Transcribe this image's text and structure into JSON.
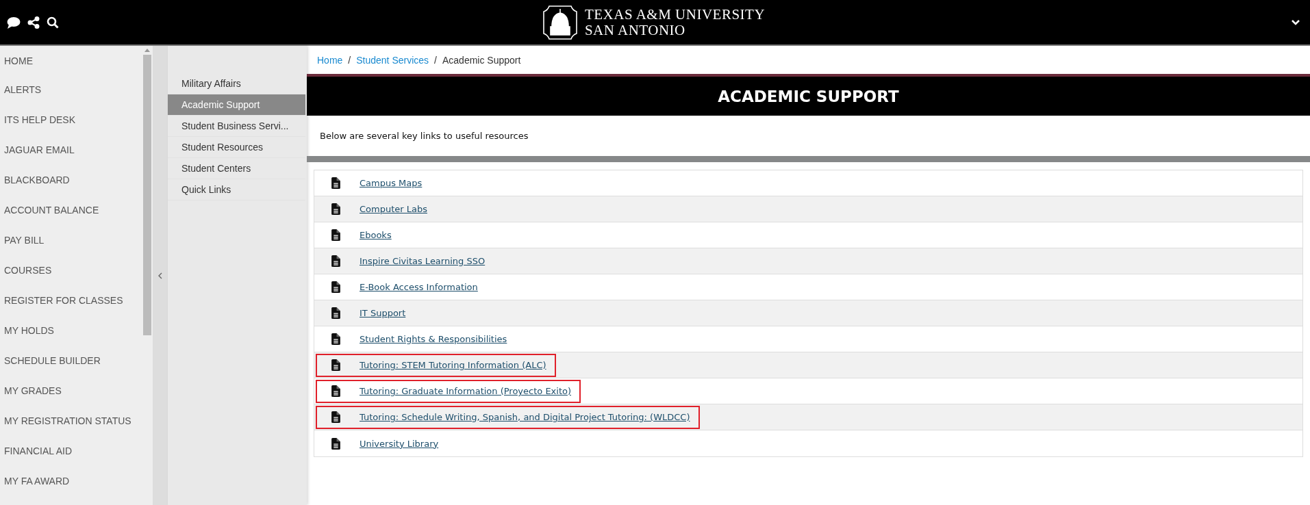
{
  "header": {
    "logo_line_1": "TEXAS A&M UNIVERSITY",
    "logo_line_2": "SAN ANTONIO"
  },
  "sidebar": {
    "items": [
      "HOME",
      "ALERTS",
      "ITS HELP DESK",
      "JAGUAR EMAIL",
      "BLACKBOARD",
      "ACCOUNT BALANCE",
      "PAY BILL",
      "COURSES",
      "REGISTER FOR CLASSES",
      "MY HOLDS",
      "SCHEDULE BUILDER",
      "MY GRADES",
      "MY REGISTRATION STATUS",
      "FINANCIAL AID",
      "MY FA AWARD"
    ]
  },
  "submenu": {
    "items": [
      {
        "label": "Military Affairs",
        "selected": false
      },
      {
        "label": "Academic Support",
        "selected": true
      },
      {
        "label": "Student Business Servi...",
        "selected": false
      },
      {
        "label": "Student Resources",
        "selected": false
      },
      {
        "label": "Student Centers",
        "selected": false
      },
      {
        "label": "Quick Links",
        "selected": false
      }
    ]
  },
  "breadcrumb": [
    {
      "label": "Home",
      "kind": "link"
    },
    {
      "label": "/",
      "kind": "separator"
    },
    {
      "label": "Student Services",
      "kind": "link"
    },
    {
      "label": "/",
      "kind": "separator"
    },
    {
      "label": "Academic Support",
      "kind": "current"
    }
  ],
  "page_title": "ACADEMIC SUPPORT",
  "intro": "Below are several key links to useful resources",
  "links": [
    {
      "label": "Campus Maps",
      "highlighted": false
    },
    {
      "label": "Computer Labs",
      "highlighted": false
    },
    {
      "label": "Ebooks",
      "highlighted": false
    },
    {
      "label": "Inspire Civitas Learning SSO",
      "highlighted": false
    },
    {
      "label": "E-Book Access Information",
      "highlighted": false
    },
    {
      "label": "IT Support",
      "highlighted": false
    },
    {
      "label": "Student Rights & Responsibilities",
      "highlighted": false
    },
    {
      "label": "Tutoring: STEM Tutoring Information (ALC)",
      "highlighted": true
    },
    {
      "label": "Tutoring: Graduate Information (Proyecto Exito)",
      "highlighted": true
    },
    {
      "label": "Tutoring: Schedule Writing, Spanish, and Digital Project Tutoring: (WLDCC)",
      "highlighted": true
    },
    {
      "label": "University Library",
      "highlighted": false
    }
  ]
}
